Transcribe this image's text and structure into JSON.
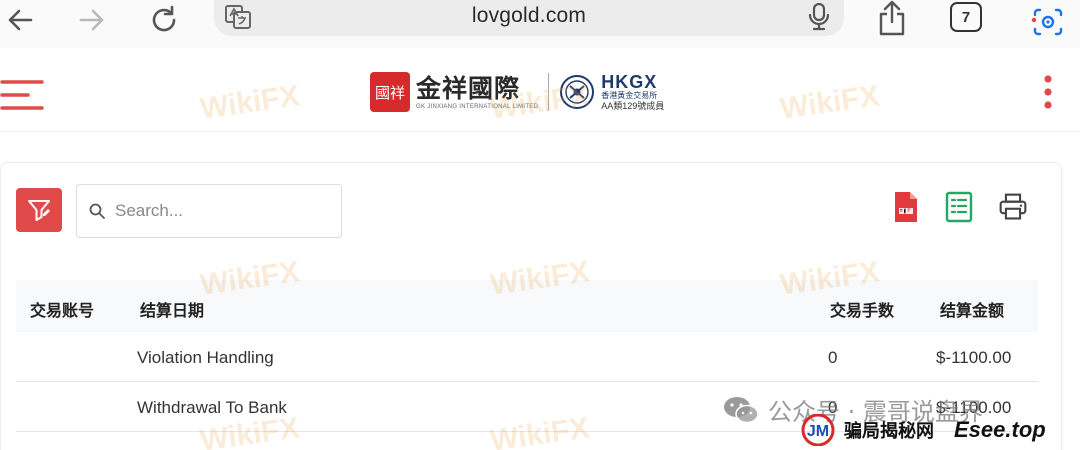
{
  "browser": {
    "url": "lovgold.com",
    "tab_count": "7"
  },
  "header": {
    "brand_cn": "金祥國際",
    "brand_en": "GK JINXIANG INTERNATIONAL LIMITED",
    "seal_text": "國祥",
    "hkgx": "HKGX",
    "hkgx_sub": "香港黃金交易所",
    "hkgx_member": "AA類129號成員"
  },
  "toolbar": {
    "search_placeholder": "Search..."
  },
  "table": {
    "columns": [
      "交易账号",
      "结算日期",
      "交易手数",
      "结算金额"
    ],
    "rows": [
      {
        "account": "",
        "date": "Violation Handling",
        "lots": "0",
        "amount": "$-1100.00"
      },
      {
        "account": "",
        "date": "Withdrawal To Bank",
        "lots": "0",
        "amount": "$-1100.00"
      }
    ]
  },
  "watermarks": {
    "wikifx": "WikiFX",
    "wechat": "公众号 · 震哥说盘界",
    "esee_cn": "骗局揭秘网",
    "esee_en": "Esee.top",
    "esee_logo": "JM"
  },
  "colors": {
    "accent_red": "#e04a4a",
    "pdf_red": "#e0393e",
    "excel_green": "#22a860",
    "hkgx_blue": "#1f3a6b"
  }
}
